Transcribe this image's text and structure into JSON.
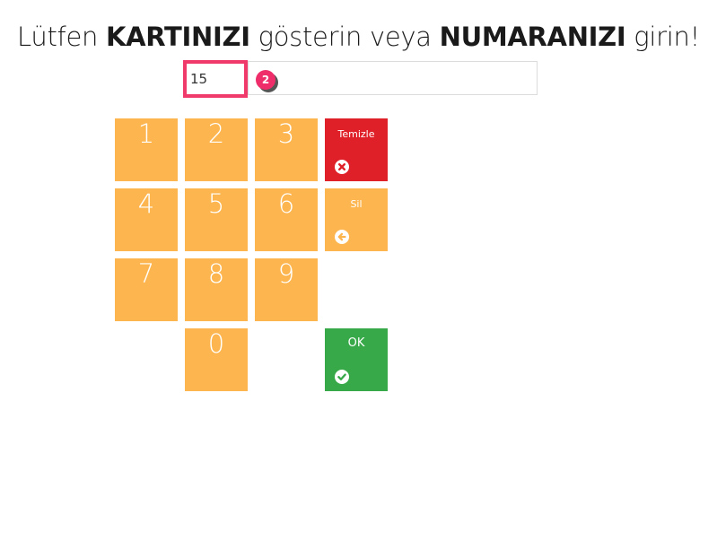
{
  "heading": {
    "part1": "Lütfen ",
    "bold1": "KARTINIZI",
    "part2": " gösterin veya ",
    "bold2": "NUMARANIZI",
    "part3": " girin!"
  },
  "entry": {
    "value": "15",
    "step_badge": "2"
  },
  "keypad": {
    "keys": [
      "1",
      "2",
      "3",
      "4",
      "5",
      "6",
      "7",
      "8",
      "9",
      "0"
    ],
    "key_color": "#fdb64f"
  },
  "actions": {
    "clear_label": "Temizle",
    "clear_icon": "times-circle-icon",
    "clear_color": "#e02028",
    "delete_label": "Sil",
    "delete_icon": "arrow-left-circle-icon",
    "ok_label": "OK",
    "ok_icon": "check-circle-icon",
    "ok_color": "#37a948"
  }
}
